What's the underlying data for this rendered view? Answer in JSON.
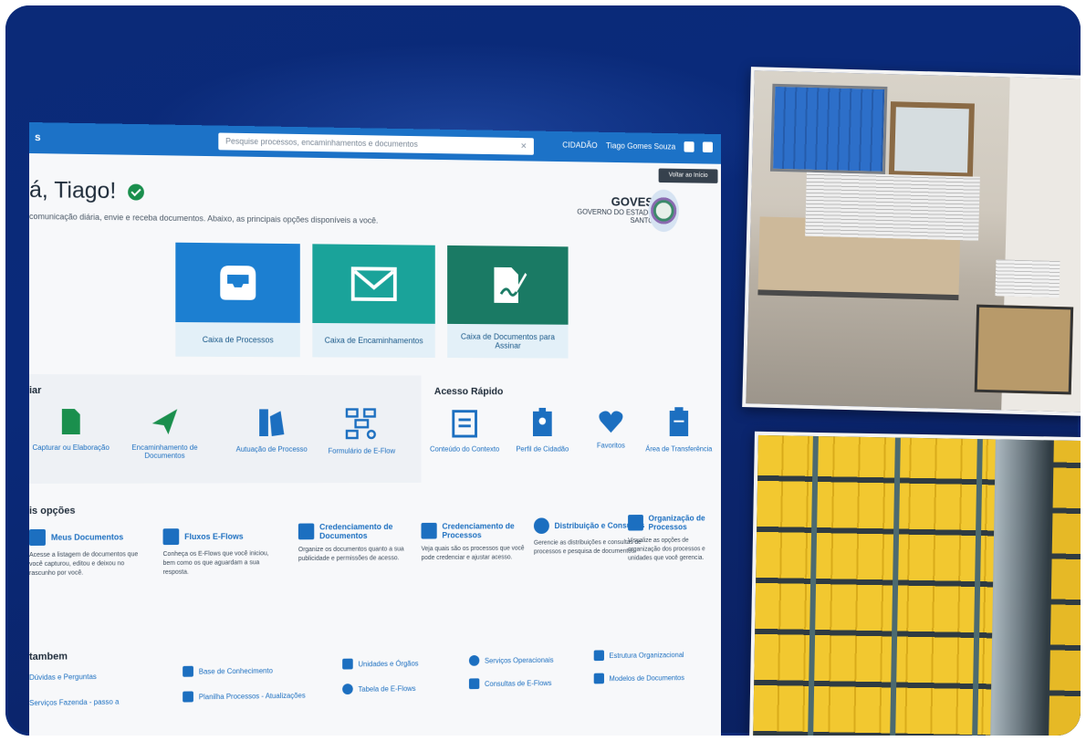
{
  "topbar": {
    "brand": "s",
    "search_placeholder": "Pesquise processos, encaminhamentos e documentos",
    "right_links": [
      "CIDADÃO",
      "Tiago Gomes Souza"
    ]
  },
  "greeting": {
    "title": "á, Tiago!",
    "subtitle": "comunicação diária, envie e receba documentos. Abaixo, as principais opções disponíveis a você."
  },
  "entity": {
    "name": "GOVES",
    "line1": "GOVERNO DO ESTADO",
    "line2": "SANTO"
  },
  "back_button": "Voltar ao Início",
  "tiles": [
    {
      "label": "Caixa de Processos"
    },
    {
      "label": "Caixa de Encaminhamentos"
    },
    {
      "label": "Caixa de Documentos para Assinar"
    }
  ],
  "quick_create": {
    "title": "iar",
    "items": [
      {
        "label": "Capturar ou Elaboração"
      },
      {
        "label": "Encaminhamento de Documentos"
      },
      {
        "label": "Autuação de Processo"
      },
      {
        "label": "Formulário de E-Flow"
      }
    ]
  },
  "quick_access": {
    "title": "Acesso Rápido",
    "items": [
      {
        "label": "Conteúdo do Contexto"
      },
      {
        "label": "Perfil de Cidadão"
      },
      {
        "label": "Favoritos"
      },
      {
        "label": "Área de Transferência"
      }
    ]
  },
  "more_options": {
    "title": "is opções",
    "items": [
      {
        "title": "Meus Documentos",
        "text": "Acesse a listagem de documentos que você capturou, editou e deixou no rascunho por você."
      },
      {
        "title": "Fluxos E-Flows",
        "text": "Conheça os E-Flows que você iniciou, bem como os que aguardam a sua resposta."
      },
      {
        "title": "Credenciamento de Documentos",
        "text": "Organize os documentos quanto a sua publicidade e permissões de acesso."
      },
      {
        "title": "Credenciamento de Processos",
        "text": "Veja quais são os processos que você pode credenciar e ajustar acesso."
      },
      {
        "title": "Distribuição e Consultas",
        "text": "Gerencie as distribuições e consultas de processos e pesquisa de documentos."
      },
      {
        "title": "Organização de Processos",
        "text": "Visualize as opções de organização dos processos e unidades que você gerencia."
      }
    ]
  },
  "see_also": {
    "title": "tambem",
    "links": [
      "Dúvidas e Perguntas",
      "Base de Conhecimento",
      "Unidades e Órgãos",
      "Serviços Operacionais",
      "Estrutura Organizacional",
      "Serviços Fazenda - passo a",
      "Planilha Processos - Atualizações",
      "Tabela de E-Flows",
      "Consultas de E-Flows",
      "Modelos de Documentos"
    ]
  },
  "colors": {
    "frame": "#0b2a78",
    "topbar": "#1c72c7",
    "tile_blue": "#1c7fd1",
    "tile_teal": "#1aa39a",
    "tile_green": "#1a7a64",
    "link": "#1c6fc0"
  }
}
